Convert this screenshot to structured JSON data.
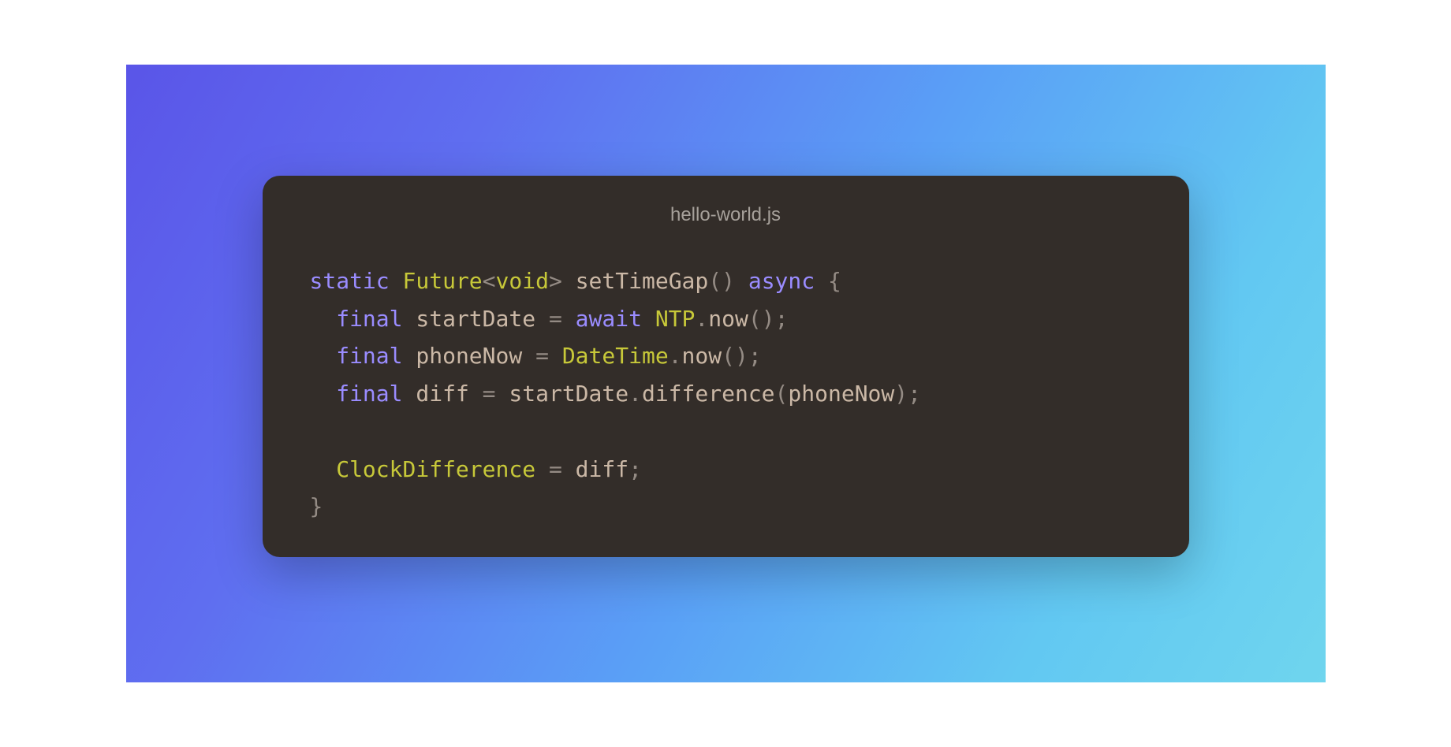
{
  "filename": "hello-world.js",
  "code": {
    "tokens": [
      [
        {
          "t": "static",
          "c": "kw"
        },
        {
          "t": " ",
          "c": "id"
        },
        {
          "t": "Future",
          "c": "type"
        },
        {
          "t": "<",
          "c": "pn"
        },
        {
          "t": "void",
          "c": "gen"
        },
        {
          "t": ">",
          "c": "pn"
        },
        {
          "t": " ",
          "c": "id"
        },
        {
          "t": "setTimeGap",
          "c": "fn"
        },
        {
          "t": "(",
          "c": "pn"
        },
        {
          "t": ")",
          "c": "pn"
        },
        {
          "t": " ",
          "c": "id"
        },
        {
          "t": "async",
          "c": "kw"
        },
        {
          "t": " ",
          "c": "id"
        },
        {
          "t": "{",
          "c": "pn"
        }
      ],
      [
        {
          "t": "  ",
          "c": "id"
        },
        {
          "t": "final",
          "c": "kw"
        },
        {
          "t": " ",
          "c": "id"
        },
        {
          "t": "startDate",
          "c": "id"
        },
        {
          "t": " ",
          "c": "id"
        },
        {
          "t": "=",
          "c": "pn"
        },
        {
          "t": " ",
          "c": "id"
        },
        {
          "t": "await",
          "c": "kw"
        },
        {
          "t": " ",
          "c": "id"
        },
        {
          "t": "NTP",
          "c": "type"
        },
        {
          "t": ".",
          "c": "pn"
        },
        {
          "t": "now",
          "c": "fn"
        },
        {
          "t": "(",
          "c": "pn"
        },
        {
          "t": ")",
          "c": "pn"
        },
        {
          "t": ";",
          "c": "pn"
        }
      ],
      [
        {
          "t": "  ",
          "c": "id"
        },
        {
          "t": "final",
          "c": "kw"
        },
        {
          "t": " ",
          "c": "id"
        },
        {
          "t": "phoneNow",
          "c": "id"
        },
        {
          "t": " ",
          "c": "id"
        },
        {
          "t": "=",
          "c": "pn"
        },
        {
          "t": " ",
          "c": "id"
        },
        {
          "t": "DateTime",
          "c": "type"
        },
        {
          "t": ".",
          "c": "pn"
        },
        {
          "t": "now",
          "c": "fn"
        },
        {
          "t": "(",
          "c": "pn"
        },
        {
          "t": ")",
          "c": "pn"
        },
        {
          "t": ";",
          "c": "pn"
        }
      ],
      [
        {
          "t": "  ",
          "c": "id"
        },
        {
          "t": "final",
          "c": "kw"
        },
        {
          "t": " ",
          "c": "id"
        },
        {
          "t": "diff",
          "c": "id"
        },
        {
          "t": " ",
          "c": "id"
        },
        {
          "t": "=",
          "c": "pn"
        },
        {
          "t": " ",
          "c": "id"
        },
        {
          "t": "startDate",
          "c": "id"
        },
        {
          "t": ".",
          "c": "pn"
        },
        {
          "t": "difference",
          "c": "fn"
        },
        {
          "t": "(",
          "c": "pn"
        },
        {
          "t": "phoneNow",
          "c": "id"
        },
        {
          "t": ")",
          "c": "pn"
        },
        {
          "t": ";",
          "c": "pn"
        }
      ],
      [
        {
          "t": " ",
          "c": "id"
        }
      ],
      [
        {
          "t": "  ",
          "c": "id"
        },
        {
          "t": "ClockDifference",
          "c": "type"
        },
        {
          "t": " ",
          "c": "id"
        },
        {
          "t": "=",
          "c": "pn"
        },
        {
          "t": " ",
          "c": "id"
        },
        {
          "t": "diff",
          "c": "id"
        },
        {
          "t": ";",
          "c": "pn"
        }
      ],
      [
        {
          "t": "}",
          "c": "pn"
        }
      ]
    ]
  }
}
